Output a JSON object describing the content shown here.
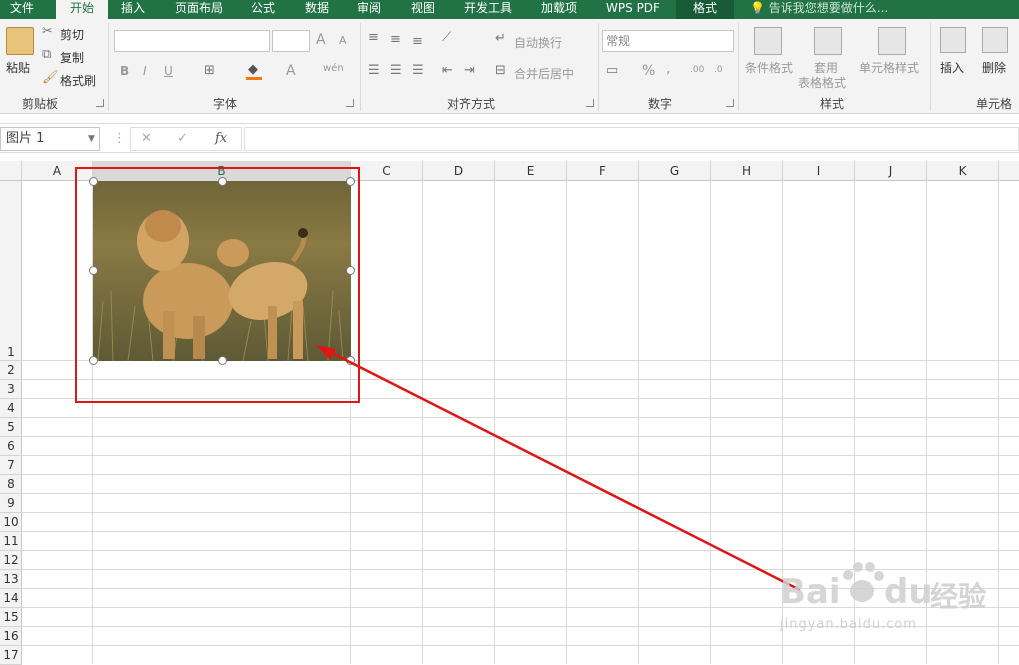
{
  "tabs": [
    "文件",
    "开始",
    "插入",
    "页面布局",
    "公式",
    "数据",
    "审阅",
    "视图",
    "开发工具",
    "加载项",
    "WPS PDF",
    "格式"
  ],
  "tell_me": "告诉我您想要做什么...",
  "ribbon": {
    "clipboard": {
      "paste": "粘贴",
      "cut": "剪切",
      "copy": "复制",
      "format_painter": "格式刷",
      "label": "剪贴板"
    },
    "font": {
      "bold": "B",
      "italic": "I",
      "underline": "U",
      "grow": "A",
      "shrink": "A",
      "phonetic": "wén",
      "label": "字体"
    },
    "alignment": {
      "wrap": "自动换行",
      "merge": "合并后居中",
      "label": "对齐方式"
    },
    "number": {
      "format": "常规",
      "percent": "%",
      "comma": ",",
      "inc_dec": ".00",
      "dec_dec": ".0",
      "label": "数字"
    },
    "styles": {
      "conditional": "条件格式",
      "table_line1": "套用",
      "table_line2": "表格格式",
      "cell_styles": "单元格样式",
      "label": "样式"
    },
    "cells": {
      "insert": "插入",
      "delete": "删除",
      "label": "单元格"
    }
  },
  "formula_bar": {
    "name_box": "图片 1",
    "fx": "fx",
    "cancel": "✕",
    "enter": "✓",
    "value": ""
  },
  "columns": [
    "A",
    "B",
    "C",
    "D",
    "E",
    "F",
    "G",
    "H",
    "I",
    "J",
    "K"
  ],
  "rows": [
    "1",
    "2",
    "3",
    "4",
    "5",
    "6",
    "7",
    "8",
    "9",
    "10",
    "11",
    "12",
    "13",
    "14",
    "15",
    "16",
    "17"
  ],
  "picture": {
    "description_name": "图片 1"
  },
  "annotation": {
    "color": "#e01515"
  },
  "watermark": {
    "brand": "Bai",
    "brand2": "du",
    "cn": "经验",
    "url": "jingyan.baidu.com"
  }
}
